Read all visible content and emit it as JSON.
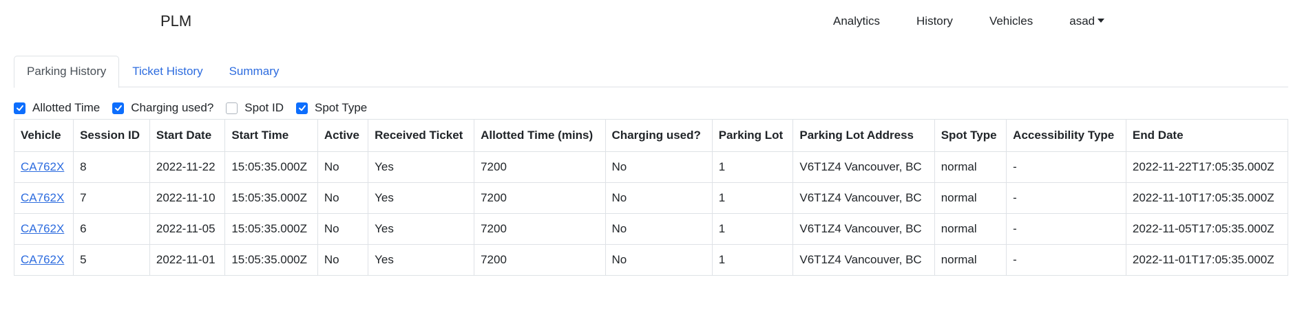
{
  "nav": {
    "brand": "PLM",
    "links": [
      "Analytics",
      "History",
      "Vehicles"
    ],
    "user": "asad"
  },
  "tabs": [
    {
      "label": "Parking History",
      "active": true
    },
    {
      "label": "Ticket History",
      "active": false
    },
    {
      "label": "Summary",
      "active": false
    }
  ],
  "filters": [
    {
      "label": "Allotted Time",
      "checked": true
    },
    {
      "label": "Charging used?",
      "checked": true
    },
    {
      "label": "Spot ID",
      "checked": false
    },
    {
      "label": "Spot Type",
      "checked": true
    }
  ],
  "colors": {
    "accent": "#0d6efd",
    "link": "#2d6cdf"
  },
  "table": {
    "headers": [
      "Vehicle",
      "Session ID",
      "Start Date",
      "Start Time",
      "Active",
      "Received Ticket",
      "Allotted Time (mins)",
      "Charging used?",
      "Parking Lot",
      "Parking Lot Address",
      "Spot Type",
      "Accessibility Type",
      "End Date"
    ],
    "rows": [
      [
        "CA762X",
        "8",
        "2022-11-22",
        "15:05:35.000Z",
        "No",
        "Yes",
        "7200",
        "No",
        "1",
        "V6T1Z4 Vancouver, BC",
        "normal",
        "-",
        "2022-11-22T17:05:35.000Z"
      ],
      [
        "CA762X",
        "7",
        "2022-11-10",
        "15:05:35.000Z",
        "No",
        "Yes",
        "7200",
        "No",
        "1",
        "V6T1Z4 Vancouver, BC",
        "normal",
        "-",
        "2022-11-10T17:05:35.000Z"
      ],
      [
        "CA762X",
        "6",
        "2022-11-05",
        "15:05:35.000Z",
        "No",
        "Yes",
        "7200",
        "No",
        "1",
        "V6T1Z4 Vancouver, BC",
        "normal",
        "-",
        "2022-11-05T17:05:35.000Z"
      ],
      [
        "CA762X",
        "5",
        "2022-11-01",
        "15:05:35.000Z",
        "No",
        "Yes",
        "7200",
        "No",
        "1",
        "V6T1Z4 Vancouver, BC",
        "normal",
        "-",
        "2022-11-01T17:05:35.000Z"
      ]
    ]
  }
}
